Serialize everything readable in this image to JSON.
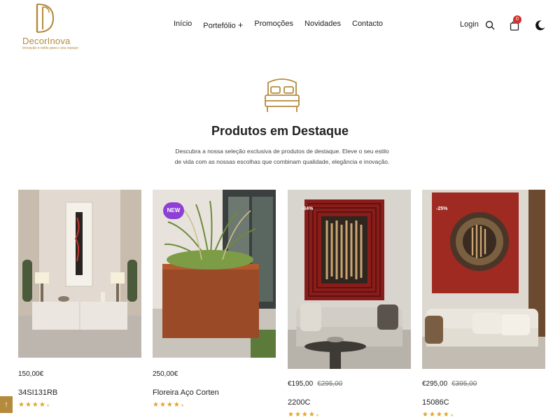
{
  "brand": {
    "name": "DecorInova",
    "tagline": "Inovação e estilo para o seu espaço"
  },
  "nav": {
    "items": [
      "Início",
      "Portefólio",
      "Promoções",
      "Novidades",
      "Contacto"
    ],
    "portfolio_plus": "+"
  },
  "actions": {
    "login": "Login",
    "cart_count": "0"
  },
  "section": {
    "title": "Produtos em Destaque",
    "description": "Descubra a nossa seleção exclusiva de produtos de destaque. Eleve o seu estilo de vida com as nossas escolhas que combinam qualidade, elegância e inovação."
  },
  "products": [
    {
      "price": "150,00€",
      "old_price": "",
      "name": "34SI131RB",
      "badge": "",
      "rating": 4
    },
    {
      "price": "250,00€",
      "old_price": "",
      "name": "Floreira Aço Corten",
      "badge": "NEW",
      "rating": 4
    },
    {
      "price": "€195,00",
      "old_price": "€295,00",
      "name": "2200C",
      "badge": "-34%",
      "rating": 4
    },
    {
      "price": "€295,00",
      "old_price": "€395,00",
      "name": "15086C",
      "badge": "-25%",
      "rating": 4
    }
  ],
  "stars": {
    "full": "★★★★",
    "empty": "★"
  },
  "colors": {
    "accent": "#b58a3c",
    "new_badge": "#8e3fd6",
    "cart_badge": "#d2302f",
    "stars": "#e1a528"
  },
  "icons": [
    "search-icon",
    "cart-icon",
    "moon-icon",
    "bed-icon",
    "arrow-up-icon"
  ],
  "scroll_top": "↑"
}
